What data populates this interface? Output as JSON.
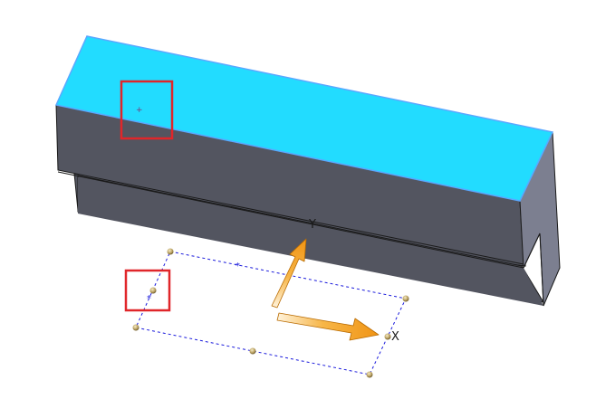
{
  "viewport": {
    "axis_labels": {
      "y": "Y",
      "x": "X"
    }
  },
  "colors": {
    "background": "#ffffff",
    "top_face": "#22dcff",
    "top_face_edge": "#5aa8ff",
    "front_face": "#535560",
    "side_face": "#7c7f90",
    "edge_line": "#1a1a1a",
    "sketch_line": "#1a1adc",
    "highlight_box": "#e0262a",
    "triad_arrow": "#f4a020",
    "triad_arrow_edge": "#b86a00",
    "handle_point": "#c9b070"
  },
  "annotations": [
    {
      "name": "highlight-top-face-origin",
      "shape": "rectangle"
    },
    {
      "name": "highlight-sketch-midpoint",
      "shape": "rectangle"
    }
  ],
  "icons": [
    "move-triad-x-arrow-icon",
    "move-triad-y-arrow-icon",
    "sketch-point-icon",
    "origin-marker-icon"
  ]
}
